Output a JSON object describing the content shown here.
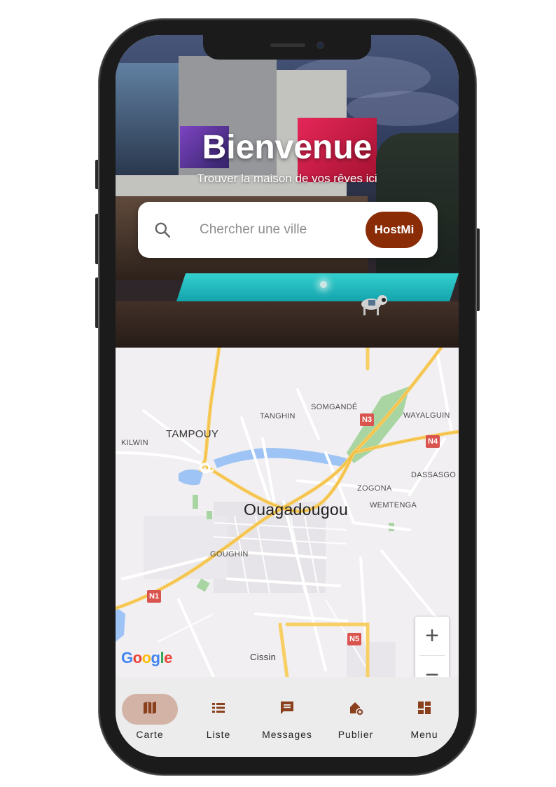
{
  "hero": {
    "title": "Bienvenue",
    "subtitle": "Trouver la maison de vos rêves ici"
  },
  "search": {
    "placeholder": "Chercher une ville",
    "value": "",
    "brand_button_label": "HostMi"
  },
  "map": {
    "labels": {
      "tanghin": "TANGHIN",
      "somgande": "SOMGANDÉ",
      "wayalguin": "WAYALGUIN",
      "tampouy": "TAMPOUY",
      "kilwin": "KILWIN",
      "dassasgo": "DASSASGO",
      "zogona": "ZOGONA",
      "wemtenga": "WEMTENGA",
      "city": "Ouagadougou",
      "goughin": "GOUGHIN",
      "cissin": "Cissin"
    },
    "highways": {
      "n3": "N3",
      "n4": "N4",
      "n1": "N1",
      "n5": "N5"
    },
    "zoom_in_label": "+",
    "zoom_out_label": "−",
    "attribution": "Google"
  },
  "bottom_nav": {
    "items": [
      {
        "label": "Carte",
        "icon": "map-icon",
        "active": true
      },
      {
        "label": "Liste",
        "icon": "list-icon",
        "active": false
      },
      {
        "label": "Messages",
        "icon": "message-icon",
        "active": false
      },
      {
        "label": "Publier",
        "icon": "add-home-icon",
        "active": false
      },
      {
        "label": "Menu",
        "icon": "dashboard-icon",
        "active": false
      }
    ]
  },
  "colors": {
    "brand": "#8a2d07",
    "nav_icon": "#8a3f1d",
    "nav_active_pill": "#d3b3a6",
    "highway_shield": "#d9534f"
  }
}
